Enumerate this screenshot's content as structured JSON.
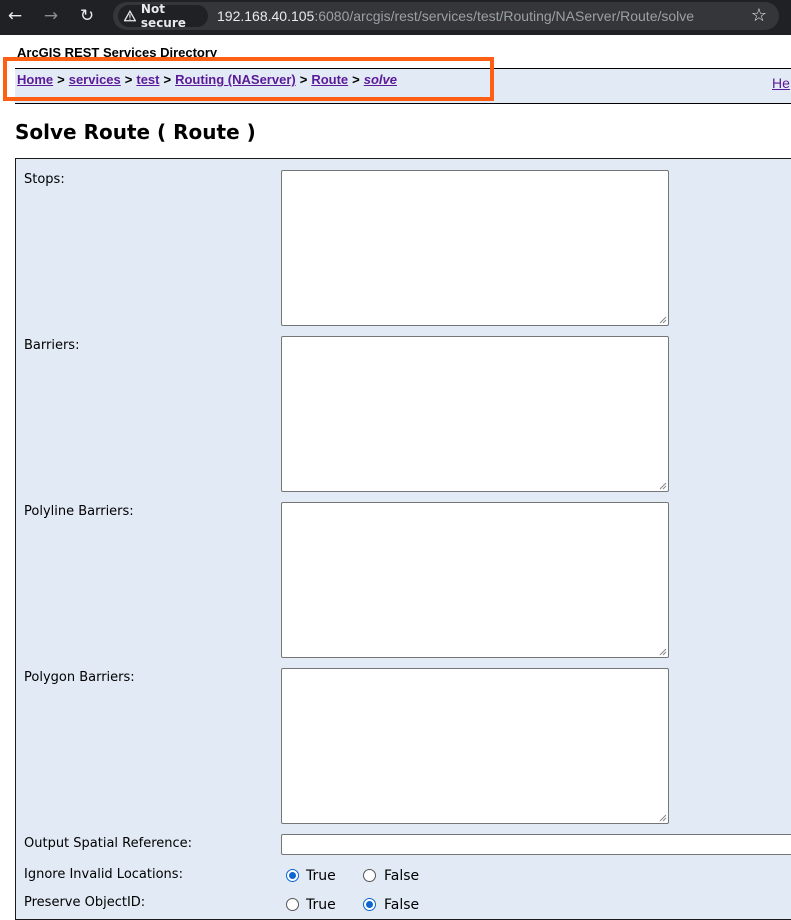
{
  "browser": {
    "security_label": "Not secure",
    "url_host": "192.168.40.105",
    "url_path": ":6080/arcgis/rest/services/test/Routing/NAServer/Route/solve"
  },
  "header": {
    "directory_title": "ArcGIS REST Services Directory",
    "help_label": "He"
  },
  "breadcrumbs": [
    {
      "label": "Home"
    },
    {
      "label": "services"
    },
    {
      "label": "test"
    },
    {
      "label": "Routing (NAServer)"
    },
    {
      "label": "Route"
    },
    {
      "label": "solve"
    }
  ],
  "breadcrumb_separator": ">",
  "page": {
    "title": "Solve Route ( Route )"
  },
  "form": {
    "stops_label": "Stops:",
    "barriers_label": "Barriers:",
    "polyline_barriers_label": "Polyline Barriers:",
    "polygon_barriers_label": "Polygon Barriers:",
    "output_sr_label": "Output Spatial Reference:",
    "ignore_invalid_label": "Ignore Invalid Locations:",
    "preserve_objectid_label": "Preserve ObjectID:",
    "true_label": "True",
    "false_label": "False",
    "ignore_invalid_value": "True",
    "preserve_objectid_value": "False"
  },
  "colors": {
    "highlight": "#ff5f15",
    "panel": "#e2ebf5",
    "link": "#5b1a98",
    "radio_checked": "#0b66d0"
  }
}
